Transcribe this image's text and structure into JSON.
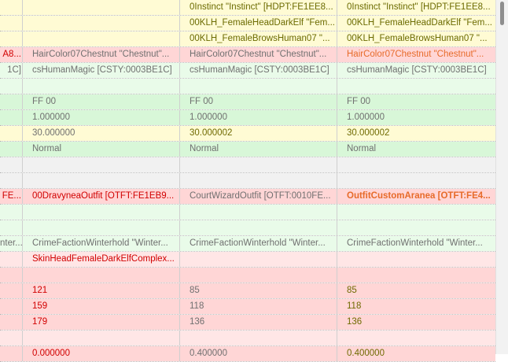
{
  "rows": [
    {
      "c": [
        {
          "t": "",
          "bg": "bg-yellow"
        },
        {
          "t": "",
          "bg": "bg-yellow"
        },
        {
          "t": "0Instinct \"Instinct\" [HDPT:FE1EE8...",
          "bg": "bg-yellow",
          "fg": "t-olive"
        },
        {
          "t": "0Instinct \"Instinct\" [HDPT:FE1EE8...",
          "bg": "bg-yellow",
          "fg": "t-olive"
        }
      ]
    },
    {
      "c": [
        {
          "t": "",
          "bg": "bg-yellow"
        },
        {
          "t": "",
          "bg": "bg-yellow"
        },
        {
          "t": "00KLH_FemaleHeadDarkElf \"Fem...",
          "bg": "bg-yellow",
          "fg": "t-olive"
        },
        {
          "t": "00KLH_FemaleHeadDarkElf \"Fem...",
          "bg": "bg-yellow",
          "fg": "t-olive"
        }
      ]
    },
    {
      "c": [
        {
          "t": "",
          "bg": "bg-yellow"
        },
        {
          "t": "",
          "bg": "bg-yellow"
        },
        {
          "t": "00KLH_FemaleBrowsHuman07 \"...",
          "bg": "bg-yellow",
          "fg": "t-olive"
        },
        {
          "t": "00KLH_FemaleBrowsHuman07 \"...",
          "bg": "bg-yellow",
          "fg": "t-olive"
        }
      ]
    },
    {
      "c": [
        {
          "t": "A8...",
          "bg": "bg-pink",
          "fg": "t-red"
        },
        {
          "t": "HairColor07Chestnut \"Chestnut\"...",
          "bg": "bg-pink",
          "fg": "t-gray"
        },
        {
          "t": "HairColor07Chestnut \"Chestnut\"...",
          "bg": "bg-pink",
          "fg": "t-gray"
        },
        {
          "t": "HairColor07Chestnut \"Chestnut\"...",
          "bg": "bg-pink",
          "fg": "t-orange-normal"
        }
      ]
    },
    {
      "c": [
        {
          "t": "1C]",
          "bg": "bg-lightgreen",
          "fg": "t-gray"
        },
        {
          "t": "csHumanMagic [CSTY:0003BE1C]",
          "bg": "bg-lightgreen",
          "fg": "t-gray"
        },
        {
          "t": "csHumanMagic [CSTY:0003BE1C]",
          "bg": "bg-lightgreen",
          "fg": "t-gray"
        },
        {
          "t": "csHumanMagic [CSTY:0003BE1C]",
          "bg": "bg-lightgreen",
          "fg": "t-gray"
        }
      ]
    },
    {
      "c": [
        {
          "t": "",
          "bg": "bg-lightgreen"
        },
        {
          "t": "",
          "bg": "bg-lightgreen"
        },
        {
          "t": "",
          "bg": "bg-lightgreen"
        },
        {
          "t": "",
          "bg": "bg-lightgreen"
        }
      ]
    },
    {
      "c": [
        {
          "t": "",
          "bg": "bg-green"
        },
        {
          "t": "FF 00",
          "bg": "bg-green",
          "fg": "t-gray"
        },
        {
          "t": "FF 00",
          "bg": "bg-green",
          "fg": "t-gray"
        },
        {
          "t": "FF 00",
          "bg": "bg-green",
          "fg": "t-gray"
        }
      ]
    },
    {
      "c": [
        {
          "t": "",
          "bg": "bg-green"
        },
        {
          "t": "1.000000",
          "bg": "bg-green",
          "fg": "t-gray"
        },
        {
          "t": "1.000000",
          "bg": "bg-green",
          "fg": "t-gray"
        },
        {
          "t": "1.000000",
          "bg": "bg-green",
          "fg": "t-gray"
        }
      ]
    },
    {
      "c": [
        {
          "t": "",
          "bg": "bg-yellow"
        },
        {
          "t": "30.000000",
          "bg": "bg-yellow",
          "fg": "t-gray"
        },
        {
          "t": "30.000002",
          "bg": "bg-yellow",
          "fg": "t-olive2"
        },
        {
          "t": "30.000002",
          "bg": "bg-yellow",
          "fg": "t-olive2"
        }
      ]
    },
    {
      "c": [
        {
          "t": "",
          "bg": "bg-green"
        },
        {
          "t": "Normal",
          "bg": "bg-green",
          "fg": "t-gray"
        },
        {
          "t": "Normal",
          "bg": "bg-green",
          "fg": "t-gray"
        },
        {
          "t": "Normal",
          "bg": "bg-green",
          "fg": "t-gray"
        }
      ]
    },
    {
      "c": [
        {
          "t": "",
          "bg": "bg-gray"
        },
        {
          "t": "",
          "bg": "bg-gray"
        },
        {
          "t": "",
          "bg": "bg-gray"
        },
        {
          "t": "",
          "bg": "bg-gray"
        }
      ]
    },
    {
      "c": [
        {
          "t": "",
          "bg": "bg-gray"
        },
        {
          "t": "",
          "bg": "bg-gray"
        },
        {
          "t": "",
          "bg": "bg-gray"
        },
        {
          "t": "",
          "bg": "bg-gray"
        }
      ]
    },
    {
      "c": [
        {
          "t": "FE...",
          "bg": "bg-pink",
          "fg": "t-red"
        },
        {
          "t": "00DravyneaOutfit [OTFT:FE1EB9...",
          "bg": "bg-pink",
          "fg": "t-red"
        },
        {
          "t": "CourtWizardOutfit [OTFT:0010FE...",
          "bg": "bg-pink",
          "fg": "t-gray"
        },
        {
          "t": "OutfitCustomAranea [OTFT:FE4...",
          "bg": "bg-pink",
          "fg": "t-orange"
        }
      ]
    },
    {
      "c": [
        {
          "t": "",
          "bg": "bg-lightgreen"
        },
        {
          "t": "",
          "bg": "bg-lightgreen"
        },
        {
          "t": "",
          "bg": "bg-lightgreen"
        },
        {
          "t": "",
          "bg": "bg-lightgreen"
        }
      ]
    },
    {
      "c": [
        {
          "t": "",
          "bg": "bg-lightgreen"
        },
        {
          "t": "",
          "bg": "bg-lightgreen"
        },
        {
          "t": "",
          "bg": "bg-lightgreen"
        },
        {
          "t": "",
          "bg": "bg-lightgreen"
        }
      ]
    },
    {
      "c": [
        {
          "t": "nter...",
          "bg": "bg-lightgreen",
          "fg": "t-gray"
        },
        {
          "t": "CrimeFactionWinterhold \"Winter...",
          "bg": "bg-lightgreen",
          "fg": "t-gray"
        },
        {
          "t": "CrimeFactionWinterhold \"Winter...",
          "bg": "bg-lightgreen",
          "fg": "t-gray"
        },
        {
          "t": "CrimeFactionWinterhold \"Winter...",
          "bg": "bg-lightgreen",
          "fg": "t-gray"
        }
      ]
    },
    {
      "c": [
        {
          "t": "",
          "bg": "bg-lightpink"
        },
        {
          "t": "SkinHeadFemaleDarkElfComplex...",
          "bg": "bg-lightpink",
          "fg": "t-red"
        },
        {
          "t": "",
          "bg": "bg-lightpink"
        },
        {
          "t": "",
          "bg": "bg-lightpink"
        }
      ]
    },
    {
      "c": [
        {
          "t": "",
          "bg": "bg-pink"
        },
        {
          "t": "",
          "bg": "bg-pink"
        },
        {
          "t": "",
          "bg": "bg-pink"
        },
        {
          "t": "",
          "bg": "bg-pink"
        }
      ]
    },
    {
      "c": [
        {
          "t": "",
          "bg": "bg-pink"
        },
        {
          "t": "121",
          "bg": "bg-pink",
          "fg": "t-red"
        },
        {
          "t": "85",
          "bg": "bg-pink",
          "fg": "t-gray"
        },
        {
          "t": "85",
          "bg": "bg-pink",
          "fg": "t-olive2"
        }
      ]
    },
    {
      "c": [
        {
          "t": "",
          "bg": "bg-pink"
        },
        {
          "t": "159",
          "bg": "bg-pink",
          "fg": "t-red"
        },
        {
          "t": "118",
          "bg": "bg-pink",
          "fg": "t-gray"
        },
        {
          "t": "118",
          "bg": "bg-pink",
          "fg": "t-olive2"
        }
      ]
    },
    {
      "c": [
        {
          "t": "",
          "bg": "bg-pink"
        },
        {
          "t": "179",
          "bg": "bg-pink",
          "fg": "t-red"
        },
        {
          "t": "136",
          "bg": "bg-pink",
          "fg": "t-gray"
        },
        {
          "t": "136",
          "bg": "bg-pink",
          "fg": "t-olive2"
        }
      ]
    },
    {
      "c": [
        {
          "t": "",
          "bg": "bg-lightpink"
        },
        {
          "t": "",
          "bg": "bg-lightpink"
        },
        {
          "t": "",
          "bg": "bg-lightpink"
        },
        {
          "t": "",
          "bg": "bg-lightpink"
        }
      ]
    },
    {
      "c": [
        {
          "t": "",
          "bg": "bg-pink"
        },
        {
          "t": "0.000000",
          "bg": "bg-pink",
          "fg": "t-red"
        },
        {
          "t": "0.400000",
          "bg": "bg-pink",
          "fg": "t-gray"
        },
        {
          "t": "0.400000",
          "bg": "bg-pink",
          "fg": "t-olive2"
        }
      ]
    }
  ]
}
